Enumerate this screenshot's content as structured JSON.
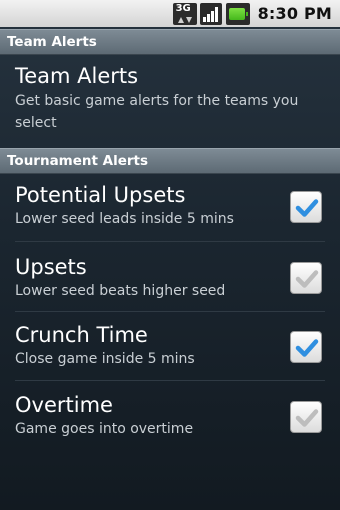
{
  "status_bar": {
    "time": "8:30 PM",
    "network_label": "3G",
    "icons": [
      "network-3g-icon",
      "signal-strength-icon",
      "battery-icon"
    ]
  },
  "sections": {
    "team": {
      "header": "Team Alerts",
      "item": {
        "title": "Team Alerts",
        "summary": "Get basic game alerts for the teams you select"
      }
    },
    "tournament": {
      "header": "Tournament Alerts",
      "items": [
        {
          "title": "Potential Upsets",
          "summary": "Lower seed leads inside 5 mins",
          "checked": true,
          "enabled": true
        },
        {
          "title": "Upsets",
          "summary": "Lower seed beats higher seed",
          "checked": true,
          "enabled": false
        },
        {
          "title": "Crunch Time",
          "summary": "Close game inside 5 mins",
          "checked": true,
          "enabled": true
        },
        {
          "title": "Overtime",
          "summary": "Game goes into overtime",
          "checked": true,
          "enabled": false
        }
      ]
    }
  },
  "colors": {
    "check_active": "#2f8fe0",
    "check_inactive": "#bdbdbd",
    "header_bg": "#6d7a84",
    "list_bg": "#1b2630"
  }
}
